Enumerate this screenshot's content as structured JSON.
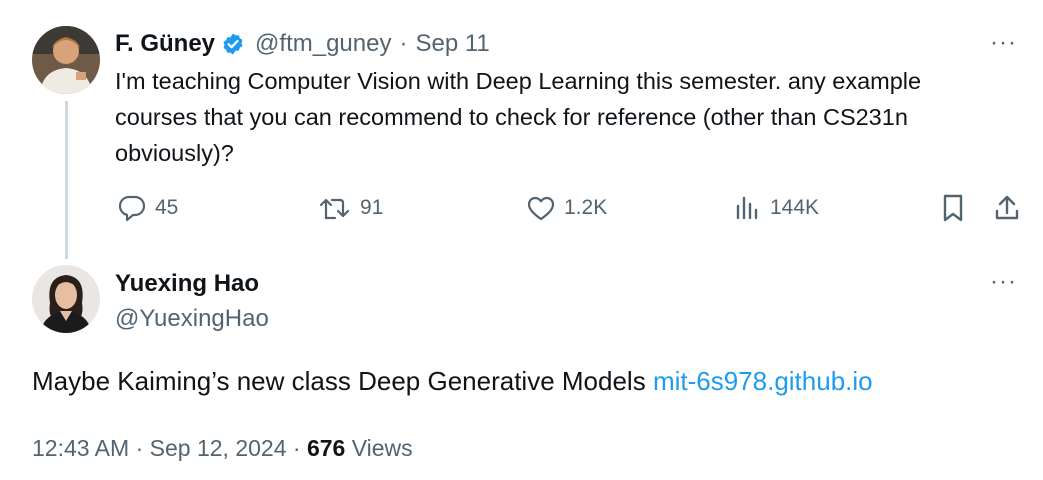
{
  "parent_tweet": {
    "author_name": "F. Güney",
    "verified": true,
    "handle": "@ftm_guney",
    "separator": "·",
    "date": "Sep 11",
    "text": "I'm teaching Computer Vision with Deep Learning this semester. any example courses that you can recommend to check for reference (other than CS231n obviously)?",
    "more_label": "···",
    "actions": {
      "replies": "45",
      "retweets": "91",
      "likes": "1.2K",
      "views": "144K"
    }
  },
  "reply_tweet": {
    "author_name": "Yuexing Hao",
    "handle": "@YuexingHao",
    "more_label": "···",
    "text_before_link": "Maybe Kaiming’s new class Deep Generative Models ",
    "link_text": "mit-6s978.github.io",
    "time": "12:43 AM",
    "separator": "·",
    "date": "Sep 12, 2024",
    "separator2": "·",
    "views_count": "676",
    "views_label": "Views"
  },
  "colors": {
    "verified_badge": "#1d9bf0",
    "link": "#1d9bf0",
    "muted_text": "#536471",
    "thread_line": "#cfd9de"
  }
}
